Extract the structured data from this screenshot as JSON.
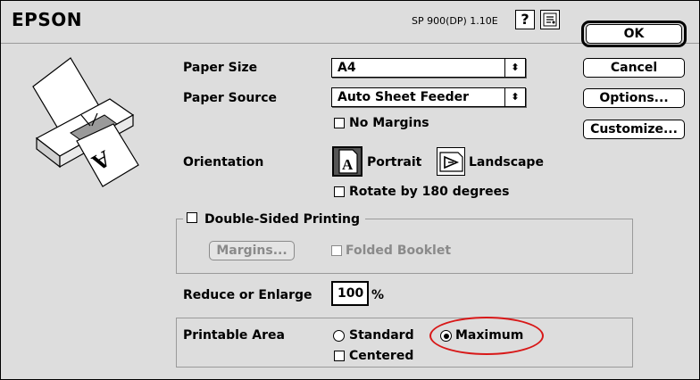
{
  "brand": "EPSON",
  "version": "SP 900(DP) 1.10E",
  "buttons": {
    "ok": "OK",
    "cancel": "Cancel",
    "options": "Options...",
    "customize": "Customize..."
  },
  "paper_size": {
    "label": "Paper Size",
    "value": "A4"
  },
  "paper_source": {
    "label": "Paper Source",
    "value": "Auto Sheet Feeder"
  },
  "no_margins": {
    "label": "No Margins",
    "checked": false
  },
  "orientation": {
    "label": "Orientation",
    "portrait": "Portrait",
    "landscape": "Landscape",
    "selected": "Portrait"
  },
  "rotate": {
    "label": "Rotate by 180 degrees",
    "checked": false
  },
  "double_sided": {
    "label": "Double-Sided Printing",
    "checked": false,
    "margins_button": "Margins...",
    "folded_booklet": "Folded Booklet"
  },
  "reduce": {
    "label": "Reduce or Enlarge",
    "value": "100",
    "unit": "%"
  },
  "printable_area": {
    "label": "Printable Area",
    "standard": "Standard",
    "maximum": "Maximum",
    "selected": "Maximum",
    "centered": "Centered"
  },
  "colors": {
    "highlight": "#d81818",
    "window": "#dddddd"
  }
}
